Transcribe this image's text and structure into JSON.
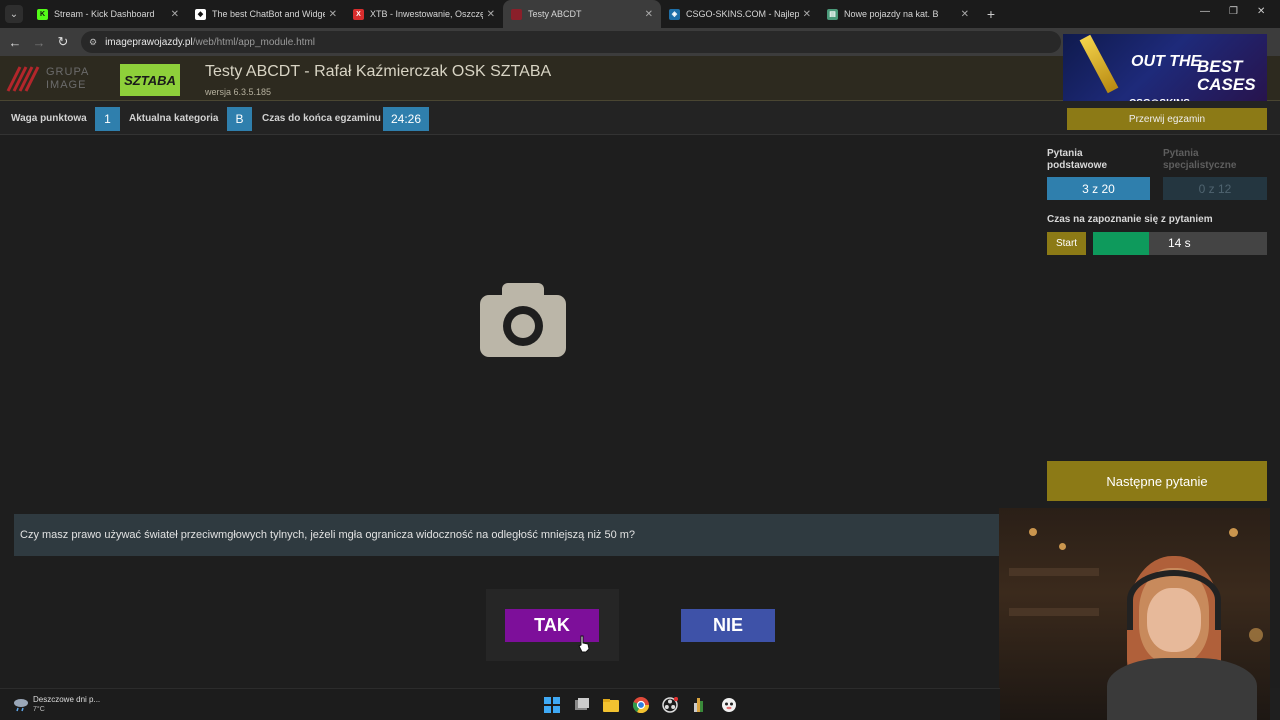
{
  "browser": {
    "tabs": [
      {
        "title": "Stream - Kick Dashboard",
        "favicon": "K",
        "favicon_color": "#53fc18",
        "favicon_text_color": "#111",
        "active": false
      },
      {
        "title": "The best ChatBot and Widgets",
        "favicon": "◆",
        "favicon_color": "#ffffff",
        "favicon_text_color": "#111",
        "active": false
      },
      {
        "title": "XTB - Inwestowanie, Oszczędno",
        "favicon": "X",
        "favicon_color": "#d92d2d",
        "favicon_text_color": "#fff",
        "active": false
      },
      {
        "title": "Testy ABCDT",
        "favicon": "",
        "favicon_color": "#8a1f2a",
        "favicon_text_color": "#fff",
        "active": true
      },
      {
        "title": "CSGO-SKINS.COM - Najlepsze",
        "favicon": "◈",
        "favicon_color": "#1e6fa8",
        "favicon_text_color": "#fff",
        "active": false
      },
      {
        "title": "Nowe pojazdy na kat. B",
        "favicon": "▤",
        "favicon_color": "#4b9a7a",
        "favicon_text_color": "#fff",
        "active": false
      }
    ],
    "url_host": "imageprawojazdy.pl",
    "url_path": "/web/html/app_module.html"
  },
  "header": {
    "logo_text": "GRUPA IMAGE",
    "school_logo_text": "SZTABA",
    "title": "Testy ABCDT - Rafał Kaźmierczak OSK SZTABA",
    "version": "wersja 6.3.5.185"
  },
  "ad": {
    "line1": "OUT THE",
    "line2": "BEST CASES",
    "brand": "CSG◎SKINS"
  },
  "status": {
    "weight_label": "Waga punktowa",
    "weight_value": "1",
    "category_label": "Aktualna kategoria",
    "category_value": "B",
    "time_label": "Czas do końca egzaminu",
    "time_value": "24:26",
    "interrupt_label": "Przerwij egzamin"
  },
  "panel": {
    "basic_label": "Pytania podstawowe",
    "basic_count": "3 z 20",
    "specialist_label": "Pytania specjalistyczne",
    "specialist_count": "0 z 12",
    "reading_time_label": "Czas na zapoznanie się z pytaniem",
    "start_label": "Start",
    "timer_text": "14 s",
    "timer_fraction": 0.32,
    "next_label": "Następne pytanie"
  },
  "question": {
    "text": "Czy masz prawo używać świateł przeciwmgłowych tylnych, jeżeli mgła ogranicza widoczność na odległość mniejszą niż 50 m?",
    "yes_label": "TAK",
    "no_label": "NIE"
  },
  "taskbar": {
    "weather_title": "Deszczowe dni p...",
    "weather_temp": "7°C"
  },
  "colors": {
    "accent_gold": "#8c7a16",
    "accent_blue": "#2f7fad",
    "yes_purple": "#7d0f9a",
    "no_blue": "#3e52a8",
    "timer_green": "#0e9a5c"
  }
}
